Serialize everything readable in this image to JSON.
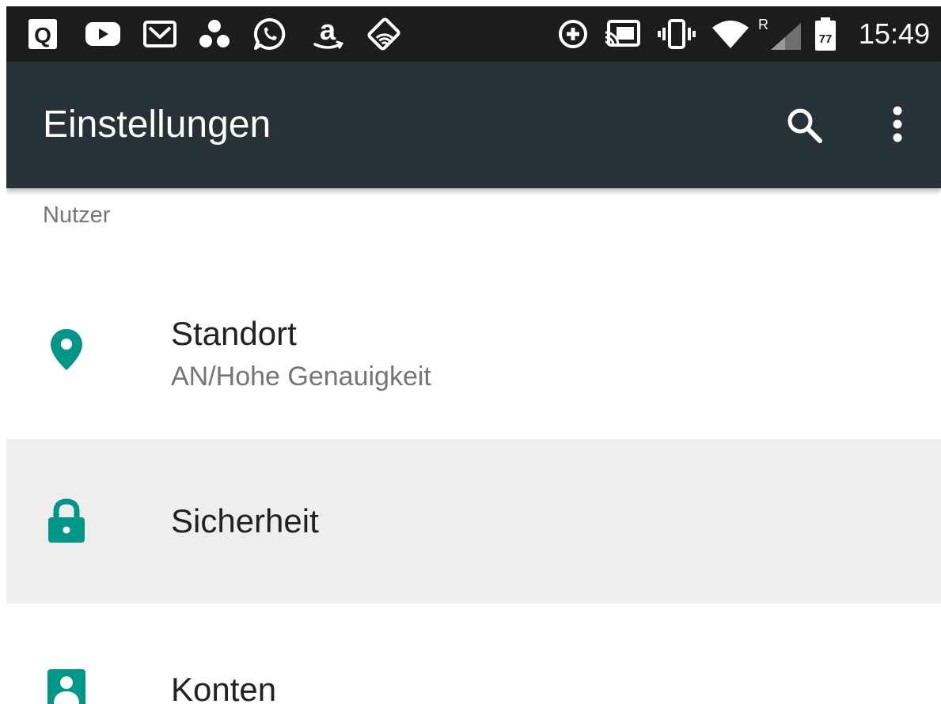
{
  "status_bar": {
    "time": "15:49",
    "notification_icons": [
      "q-app-icon",
      "youtube-icon",
      "gmail-icon",
      "cluster-dots-icon",
      "whatsapp-icon",
      "amazon-icon",
      "cast-tag-icon"
    ],
    "system_icons": [
      "data-saver-icon",
      "cast-icon",
      "vibrate-icon",
      "wifi-icon",
      "signal-roaming-icon",
      "battery-icon"
    ],
    "roaming_label": "R",
    "battery_level": "77"
  },
  "toolbar": {
    "title": "Einstellungen",
    "search_icon": "search-icon",
    "menu_icon": "more-vert-icon"
  },
  "section": {
    "header": "Nutzer"
  },
  "rows": [
    {
      "title": "Standort",
      "summary": "AN/Hohe Genauigkeit",
      "icon": "location-pin-icon"
    },
    {
      "title": "Sicherheit",
      "icon": "lock-icon",
      "highlighted": true
    },
    {
      "title": "Konten",
      "icon": "account-box-icon"
    }
  ],
  "colors": {
    "status_bar": "#1c1c1c",
    "toolbar": "#263238",
    "accent": "#009688",
    "highlight": "#eeeeee",
    "primary_text": "#212121",
    "secondary_text": "#757575"
  }
}
